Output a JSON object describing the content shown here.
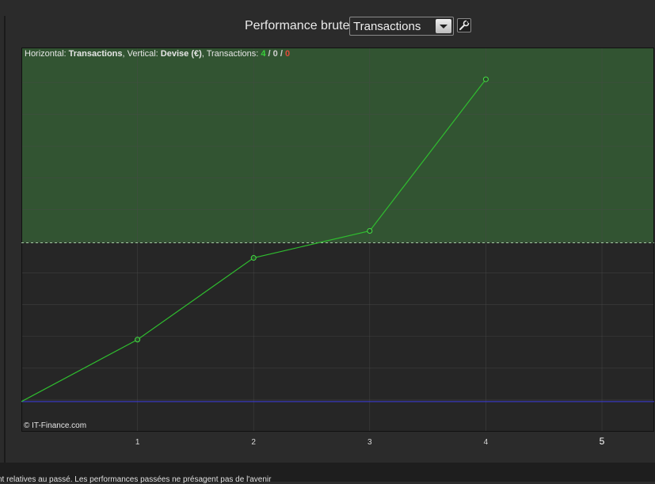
{
  "header": {
    "label": "Performance brute",
    "select_value": "Transactions"
  },
  "chart_info": {
    "horizontal_label": "Horizontal: ",
    "horizontal_value": "Transactions",
    "vertical_label": ", Vertical: ",
    "vertical_value": "Devise (€)",
    "transactions_label": ", Transactions: ",
    "count_win": "4",
    "count_neutral": "0",
    "count_loss": "0",
    "separator": " / "
  },
  "copyright": "© IT-Finance.com",
  "footer_text": "nt relatives au passé. Les performances passées ne présagent pas de l'avenir",
  "chart_data": {
    "type": "line",
    "x": [
      0,
      1,
      2,
      3,
      4
    ],
    "y": [
      0,
      78,
      181,
      215,
      406
    ],
    "xlim": [
      0,
      5.45
    ],
    "ylim": [
      -38,
      446
    ],
    "x_ticks": [
      "1",
      "2",
      "3",
      "4",
      "5"
    ],
    "baseline": 0,
    "dashed_level": 200,
    "grid": true,
    "colors": {
      "positive_zone": "#325432",
      "negative_zone": "#262626",
      "line": "#2fbd2f",
      "baseline": "#3b3bd0",
      "dashed": "#a8c8a8",
      "grid": "#4a4a4a"
    }
  }
}
